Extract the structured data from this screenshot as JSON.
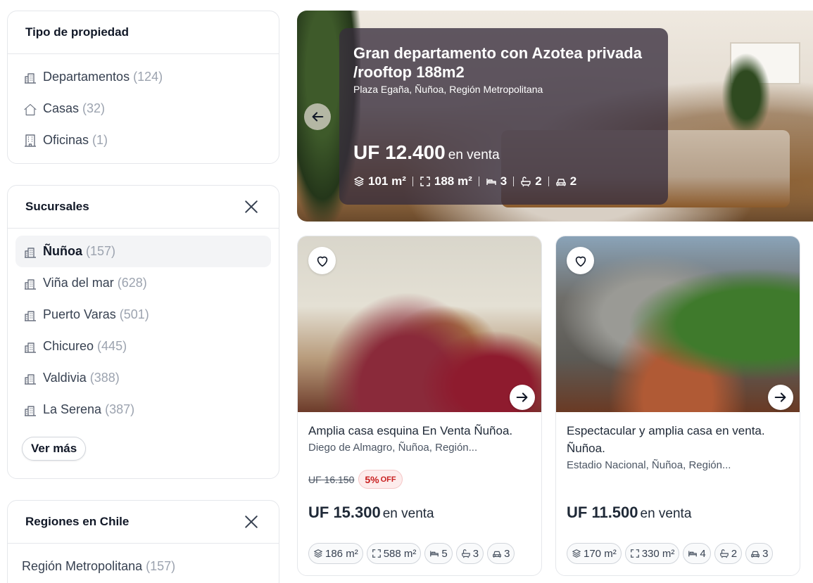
{
  "property_type": {
    "title": "Tipo de propiedad",
    "items": [
      {
        "label": "Departamentos",
        "count": "(124)"
      },
      {
        "label": "Casas",
        "count": "(32)"
      },
      {
        "label": "Oficinas",
        "count": "(1)"
      }
    ]
  },
  "branches": {
    "title": "Sucursales",
    "items": [
      {
        "label": "Ñuñoa",
        "count": "(157)"
      },
      {
        "label": "Viña del mar",
        "count": "(628)"
      },
      {
        "label": "Puerto Varas",
        "count": "(501)"
      },
      {
        "label": "Chicureo",
        "count": "(445)"
      },
      {
        "label": "Valdivia",
        "count": "(388)"
      },
      {
        "label": "La Serena",
        "count": "(387)"
      }
    ],
    "more_label": "Ver más"
  },
  "regions": {
    "title": "Regiones en Chile",
    "items": [
      {
        "label": "Región Metropolitana",
        "count": "(157)"
      }
    ]
  },
  "hero": {
    "title": "Gran departamento con Azotea privada /rooftop 188m2",
    "address": "Plaza Egaña, Ñuñoa, Región Metropolitana",
    "price": "UF 12.400",
    "price_suffix": "en venta",
    "features": {
      "built": "101 m²",
      "total": "188 m²",
      "bedrooms": "3",
      "bathrooms": "2",
      "parking": "2"
    }
  },
  "cards": [
    {
      "title": "Amplia casa esquina En Venta Ñuñoa.",
      "address": "Diego de Almagro, Ñuñoa, Región...",
      "old_price": "UF 16.150",
      "discount": "5%",
      "discount_suffix": "OFF",
      "price": "UF 15.300",
      "price_suffix": "en venta",
      "features": {
        "built": "186 m²",
        "total": "588 m²",
        "bedrooms": "5",
        "bathrooms": "3",
        "parking": "3"
      }
    },
    {
      "title": "Espectacular y amplia casa en venta. Ñuñoa.",
      "address": "Estadio Nacional, Ñuñoa, Región...",
      "price": "UF 11.500",
      "price_suffix": "en venta",
      "features": {
        "built": "170 m²",
        "total": "330 m²",
        "bedrooms": "4",
        "bathrooms": "2",
        "parking": "3"
      }
    }
  ],
  "icons": {
    "building": "building-icon",
    "house": "house-icon",
    "office": "office-icon",
    "close": "close-icon",
    "heart": "heart-icon",
    "arrow_left": "arrow-left-icon",
    "arrow_right": "arrow-right-icon",
    "layers": "layers-icon",
    "expand": "expand-icon",
    "bed": "bed-icon",
    "bath": "bath-icon",
    "car": "car-icon"
  },
  "colors": {
    "discount_text": "#c81e1e",
    "discount_bg": "#fdecec",
    "hero_overlay": "#372d3c"
  }
}
